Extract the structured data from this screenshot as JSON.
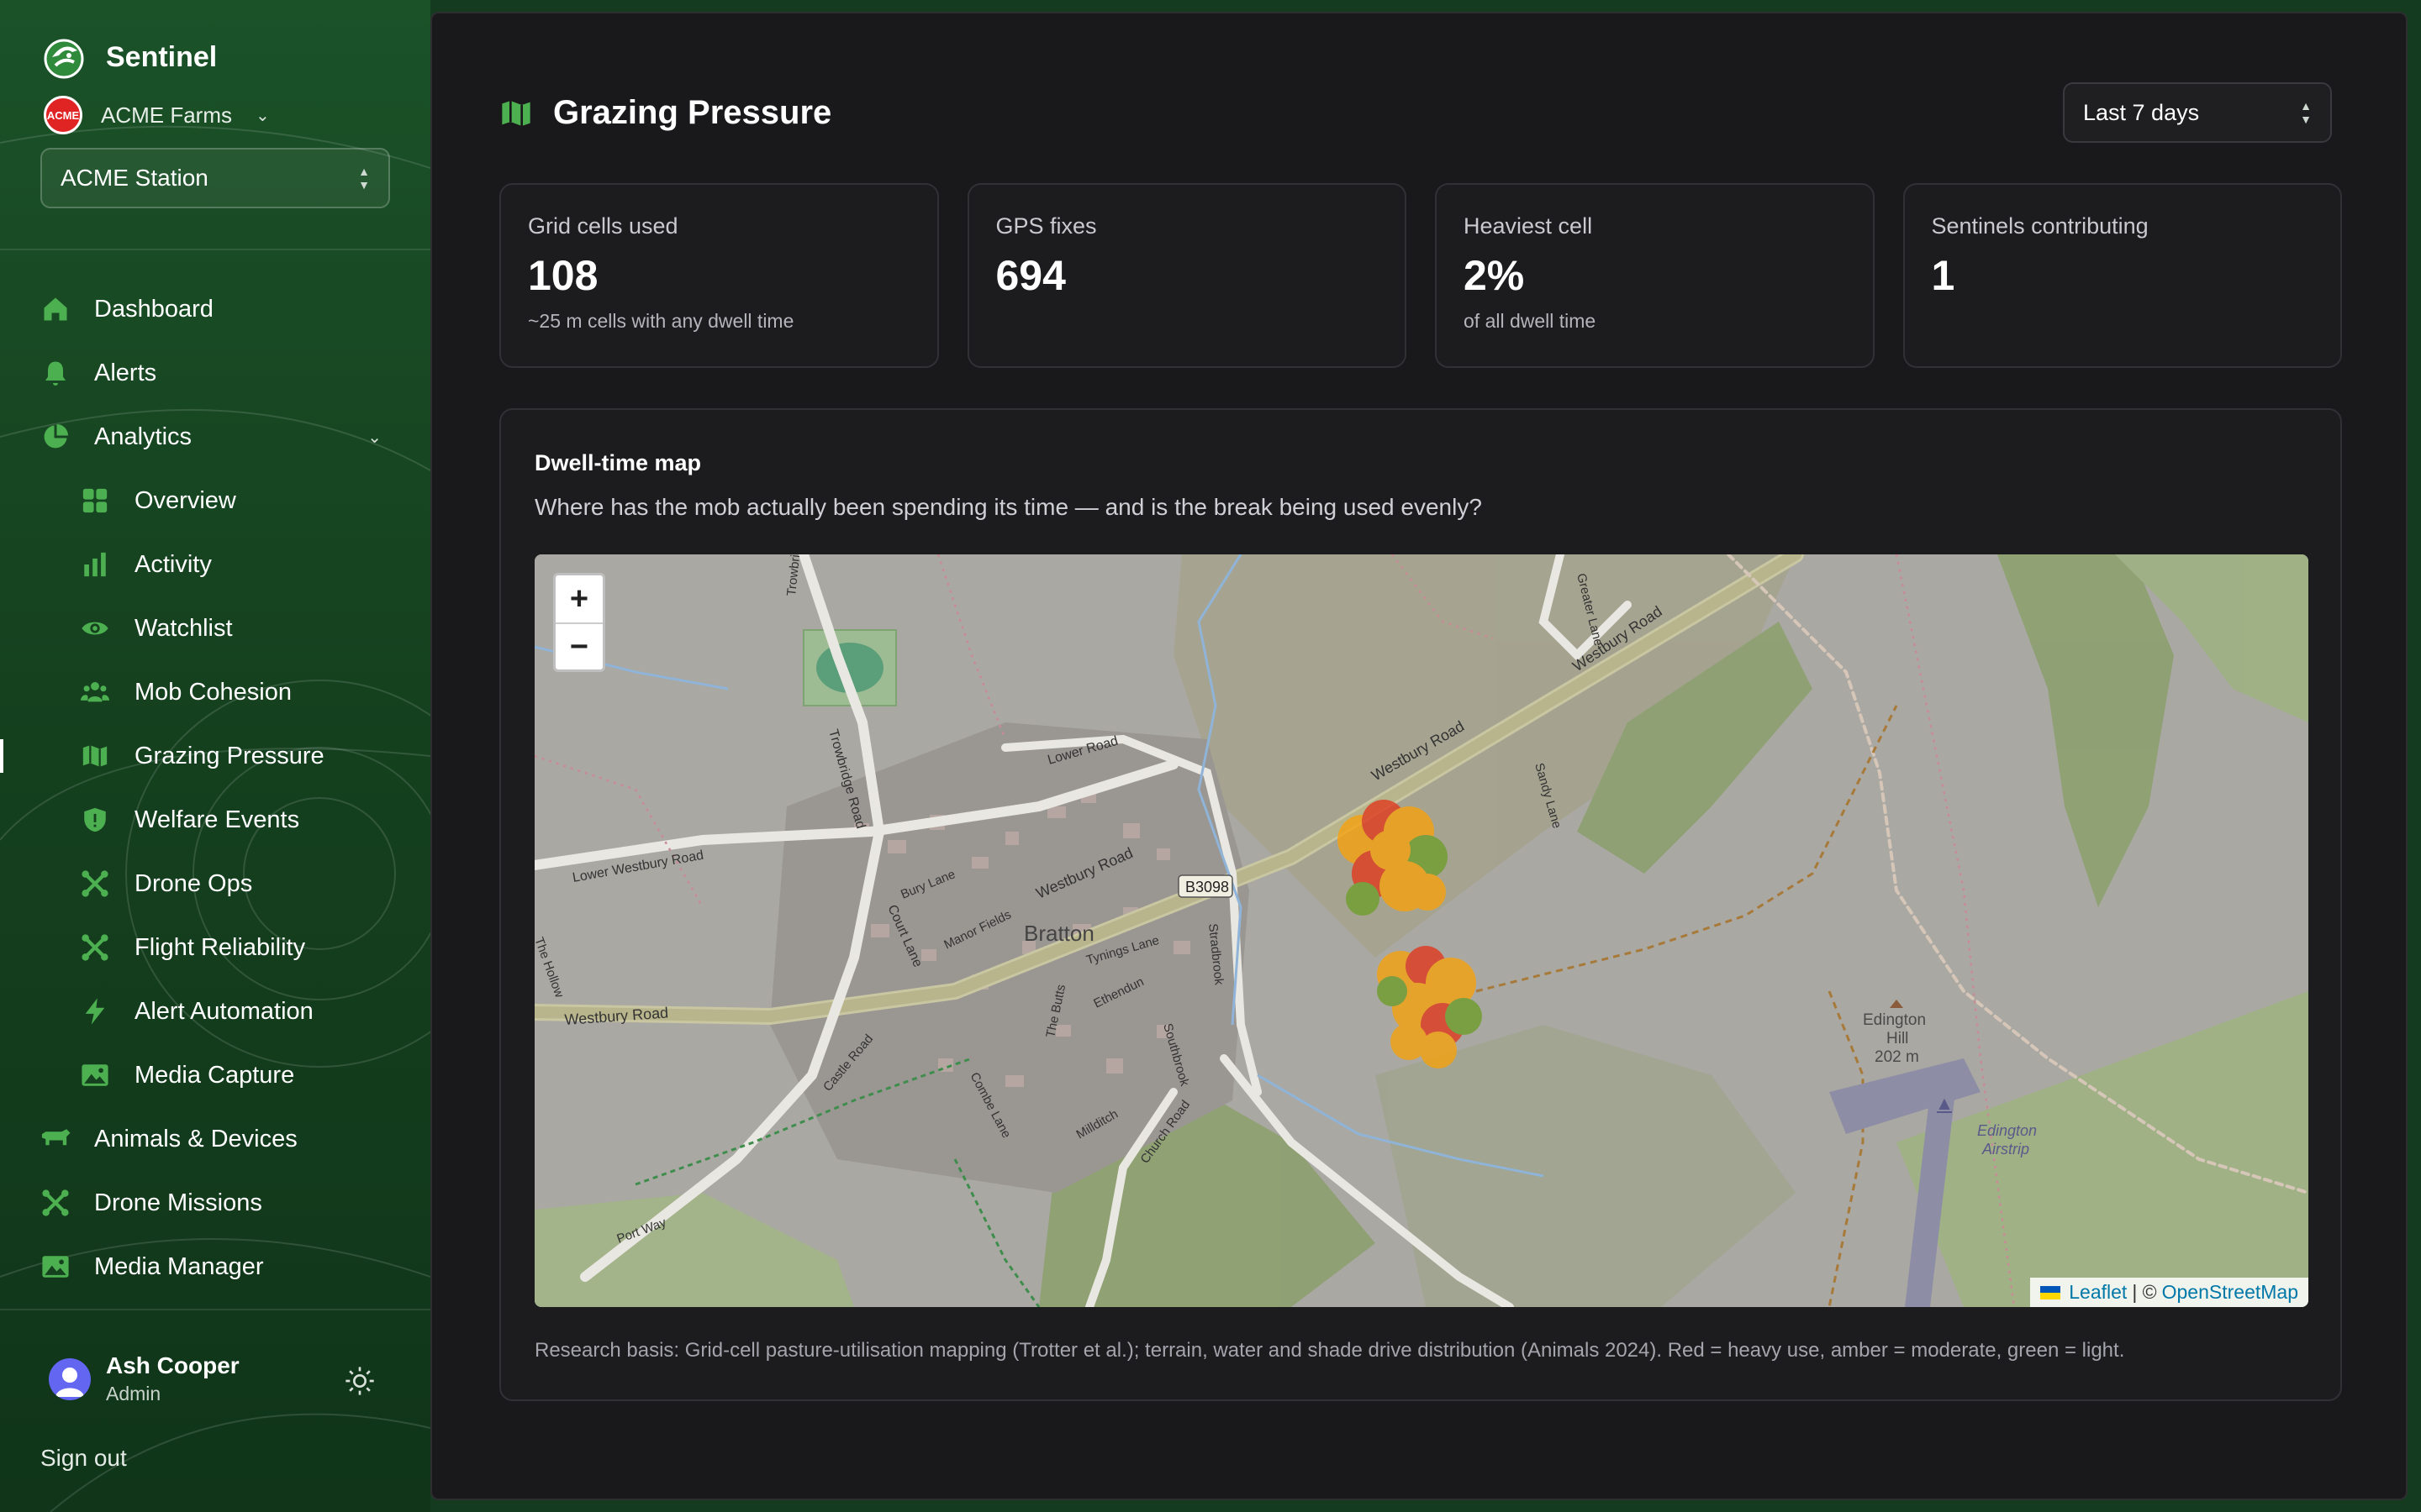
{
  "sidebar": {
    "brand": "Sentinel",
    "org": "ACME Farms",
    "org_logo_text": "ACME",
    "station": "ACME Station",
    "nav": [
      {
        "label": "Dashboard",
        "icon": "home-icon"
      },
      {
        "label": "Alerts",
        "icon": "bell-icon"
      },
      {
        "label": "Analytics",
        "icon": "pie-chart-icon",
        "expanded": true
      },
      {
        "label": "Overview",
        "icon": "grid-icon"
      },
      {
        "label": "Activity",
        "icon": "bar-chart-icon"
      },
      {
        "label": "Watchlist",
        "icon": "eye-icon"
      },
      {
        "label": "Mob Cohesion",
        "icon": "users-icon"
      },
      {
        "label": "Grazing Pressure",
        "icon": "map-icon",
        "active": true
      },
      {
        "label": "Welfare Events",
        "icon": "shield-icon"
      },
      {
        "label": "Drone Ops",
        "icon": "drone-icon"
      },
      {
        "label": "Flight Reliability",
        "icon": "drone-icon"
      },
      {
        "label": "Alert Automation",
        "icon": "bolt-icon"
      },
      {
        "label": "Media Capture",
        "icon": "image-icon"
      },
      {
        "label": "Animals & Devices",
        "icon": "cow-icon"
      },
      {
        "label": "Drone Missions",
        "icon": "drone-icon"
      },
      {
        "label": "Media Manager",
        "icon": "image-icon"
      }
    ],
    "user": {
      "name": "Ash Cooper",
      "role": "Admin"
    },
    "sign_out": "Sign out"
  },
  "header": {
    "title": "Grazing Pressure",
    "range": "Last 7 days"
  },
  "stats": [
    {
      "label": "Grid cells used",
      "value": "108",
      "sub": "~25 m cells with any dwell time"
    },
    {
      "label": "GPS fixes",
      "value": "694",
      "sub": ""
    },
    {
      "label": "Heaviest cell",
      "value": "2%",
      "sub": "of all dwell time"
    },
    {
      "label": "Sentinels contributing",
      "value": "1",
      "sub": ""
    }
  ],
  "card": {
    "title": "Dwell-time map",
    "description": "Where has the mob actually been spending its time — and is the break being used evenly?",
    "research": "Research basis: Grid-cell pasture-utilisation mapping (Trotter et al.); terrain, water and shade drive distribution (Animals 2024). Red = heavy use, amber = moderate, green = light."
  },
  "map": {
    "zoom_in": "+",
    "zoom_out": "−",
    "attribution": {
      "leaflet": "Leaflet",
      "sep": "| ©",
      "osm": "OpenStreetMap"
    },
    "labels": {
      "town": "Bratton",
      "road_b3098": "B3098",
      "westbury_road": "Westbury Road",
      "lower_westbury_road": "Lower Westbury Road",
      "lower_road": "Lower Road",
      "trowbridge_road": "Trowbridge Road",
      "bury_lane": "Bury Lane",
      "court_lane": "Court Lane",
      "manor_fields": "Manor Fields",
      "tynings_lane": "Tynings Lane",
      "the_butts": "The Butts",
      "ethendun": "Ethendun",
      "stradbrook": "Stradbrook",
      "castle_road": "Castle Road",
      "combe_lane": "Combe Lane",
      "millditch": "Millditch",
      "church_road": "Church Road",
      "port_way": "Port Way",
      "the_hollow": "The Hollow",
      "sandy_lane": "Sandy Lane",
      "greater_lane": "Greater Lane",
      "southbrook": "Southbrook",
      "hill_name": "Edington",
      "hill_name2": "Hill",
      "hill_height": "202 m",
      "airstrip": "Edington",
      "airstrip2": "Airstrip"
    },
    "heat_colors": {
      "heavy": "#e03a1e",
      "moderate": "#f6a20f",
      "light": "#6f9e2c"
    }
  }
}
